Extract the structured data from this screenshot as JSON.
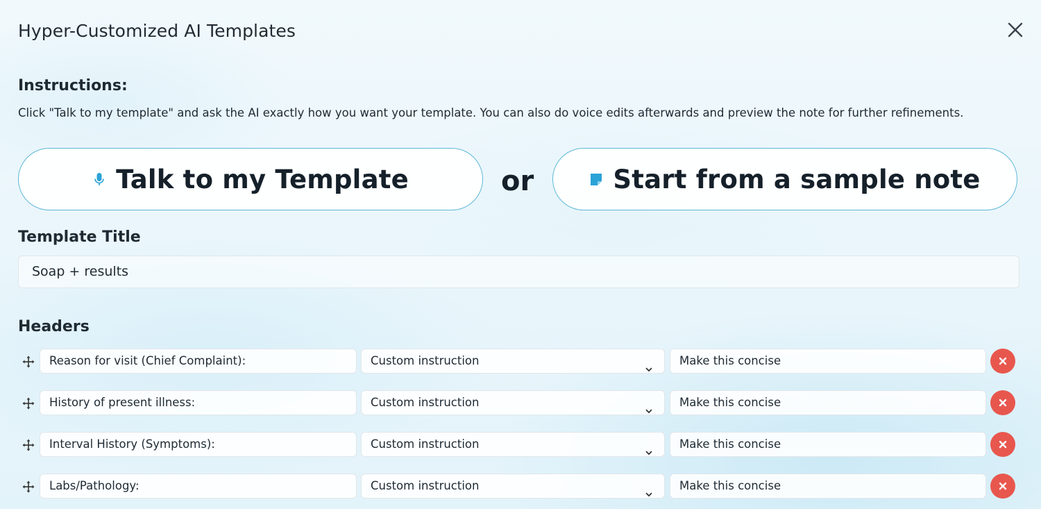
{
  "modal": {
    "title": "Hyper-Customized AI Templates",
    "close_icon": "close-icon"
  },
  "instructions": {
    "heading": "Instructions:",
    "text": "Click \"Talk to my template\" and ask the AI exactly how you want your template. You can also do voice edits afterwards and preview the note for further refinements."
  },
  "actions": {
    "talk_label": "Talk to my Template",
    "talk_icon": "microphone-icon",
    "or_label": "or",
    "sample_label": "Start from a sample note",
    "sample_icon": "sticky-note-icon"
  },
  "template_title": {
    "label": "Template Title",
    "value": "Soap + results"
  },
  "headers": {
    "label": "Headers",
    "rows": [
      {
        "name": "Reason for visit (Chief Complaint):",
        "type": "Custom instruction",
        "instruction": "Make this concise"
      },
      {
        "name": "History of present illness:",
        "type": "Custom instruction",
        "instruction": "Make this concise"
      },
      {
        "name": "Interval History (Symptoms):",
        "type": "Custom instruction",
        "instruction": "Make this concise"
      },
      {
        "name": "Labs/Pathology:",
        "type": "Custom instruction",
        "instruction": "Make this concise"
      }
    ]
  },
  "colors": {
    "accent": "#2ba3d6",
    "button_border": "#5fb8d6",
    "delete": "#e8574e"
  }
}
